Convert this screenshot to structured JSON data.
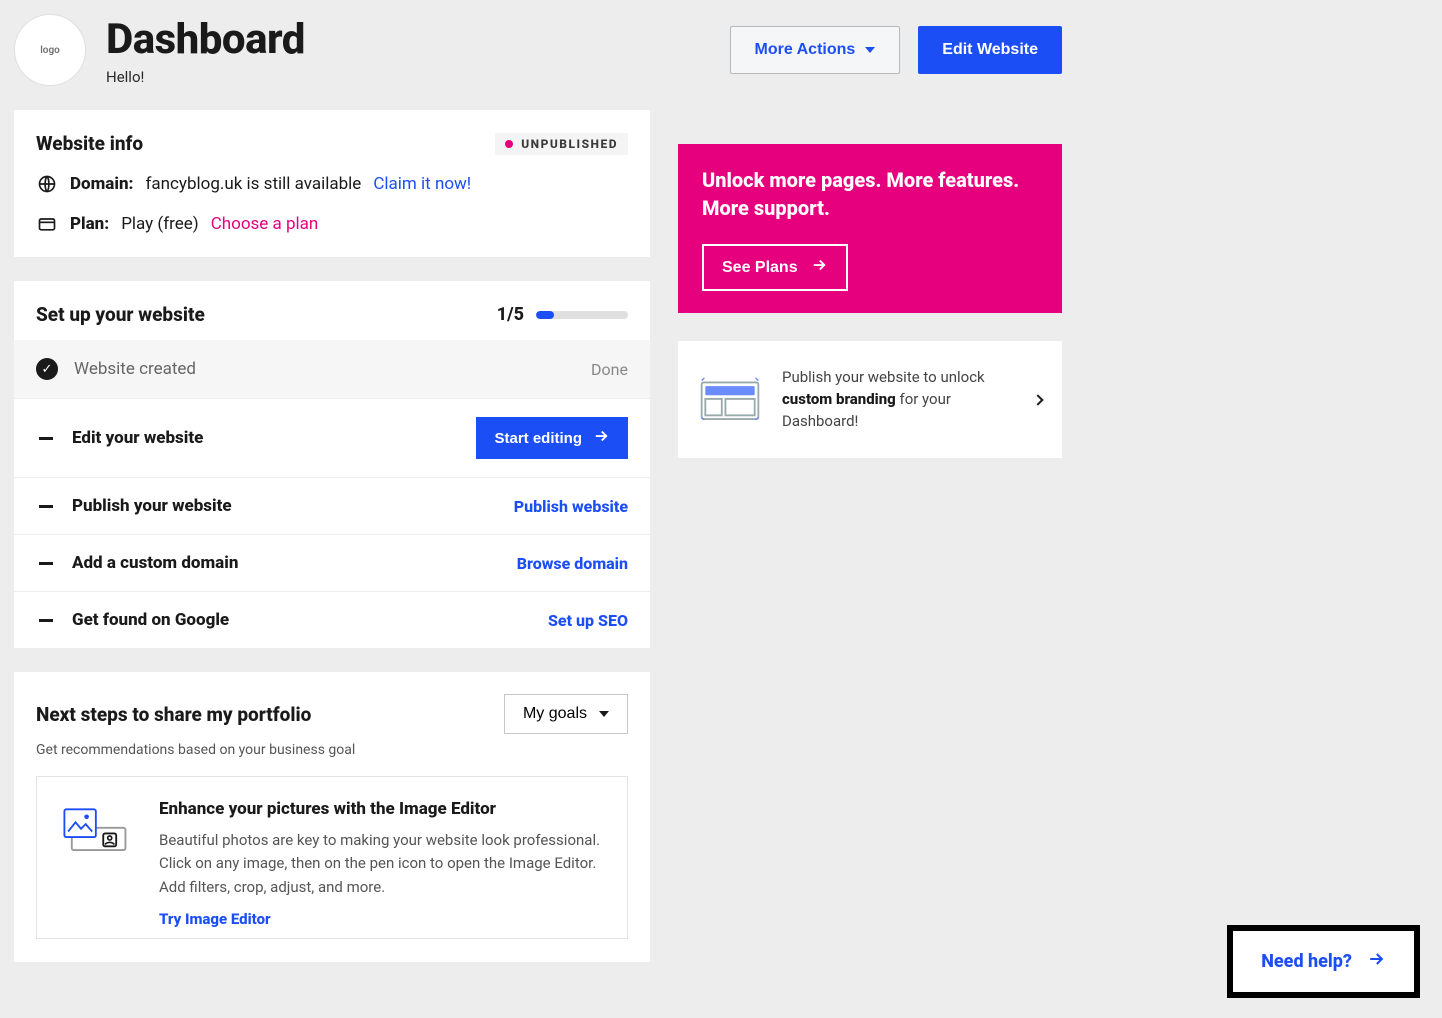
{
  "logo_text": "logo",
  "header": {
    "title": "Dashboard",
    "greeting": "Hello!",
    "more_actions": "More Actions",
    "edit_website": "Edit Website"
  },
  "website_info": {
    "title": "Website info",
    "badge": "UNPUBLISHED",
    "domain_label": "Domain:",
    "domain_value": "fancyblog.uk is still available",
    "domain_cta": "Claim it now!",
    "plan_label": "Plan:",
    "plan_value": "Play (free)",
    "plan_cta": "Choose a plan"
  },
  "setup": {
    "title": "Set up your website",
    "progress_text": "1/5",
    "progress_percent": 20,
    "items": [
      {
        "label": "Website created",
        "status": "Done",
        "done": true
      },
      {
        "label": "Edit your website",
        "action": "Start editing",
        "action_type": "button"
      },
      {
        "label": "Publish your website",
        "action": "Publish website",
        "action_type": "link"
      },
      {
        "label": "Add a custom domain",
        "action": "Browse domain",
        "action_type": "link"
      },
      {
        "label": "Get found on Google",
        "action": "Set up SEO",
        "action_type": "link"
      }
    ]
  },
  "next_steps": {
    "title": "Next steps to share my portfolio",
    "subtitle": "Get recommendations based on your business goal",
    "goals_button": "My goals",
    "tip_title": "Enhance your pictures with the Image Editor",
    "tip_body": "Beautiful photos are key to making your website look professional. Click on any image, then on the pen icon to open the Image Editor. Add filters, crop, adjust, and more.",
    "tip_cta": "Try Image Editor"
  },
  "promo": {
    "title": "Unlock more pages. More features. More support.",
    "cta": "See Plans"
  },
  "publish_hint": {
    "pre": "Publish your website to unlock ",
    "bold": "custom branding",
    "post": " for your Dashboard!"
  },
  "need_help": "Need help?"
}
